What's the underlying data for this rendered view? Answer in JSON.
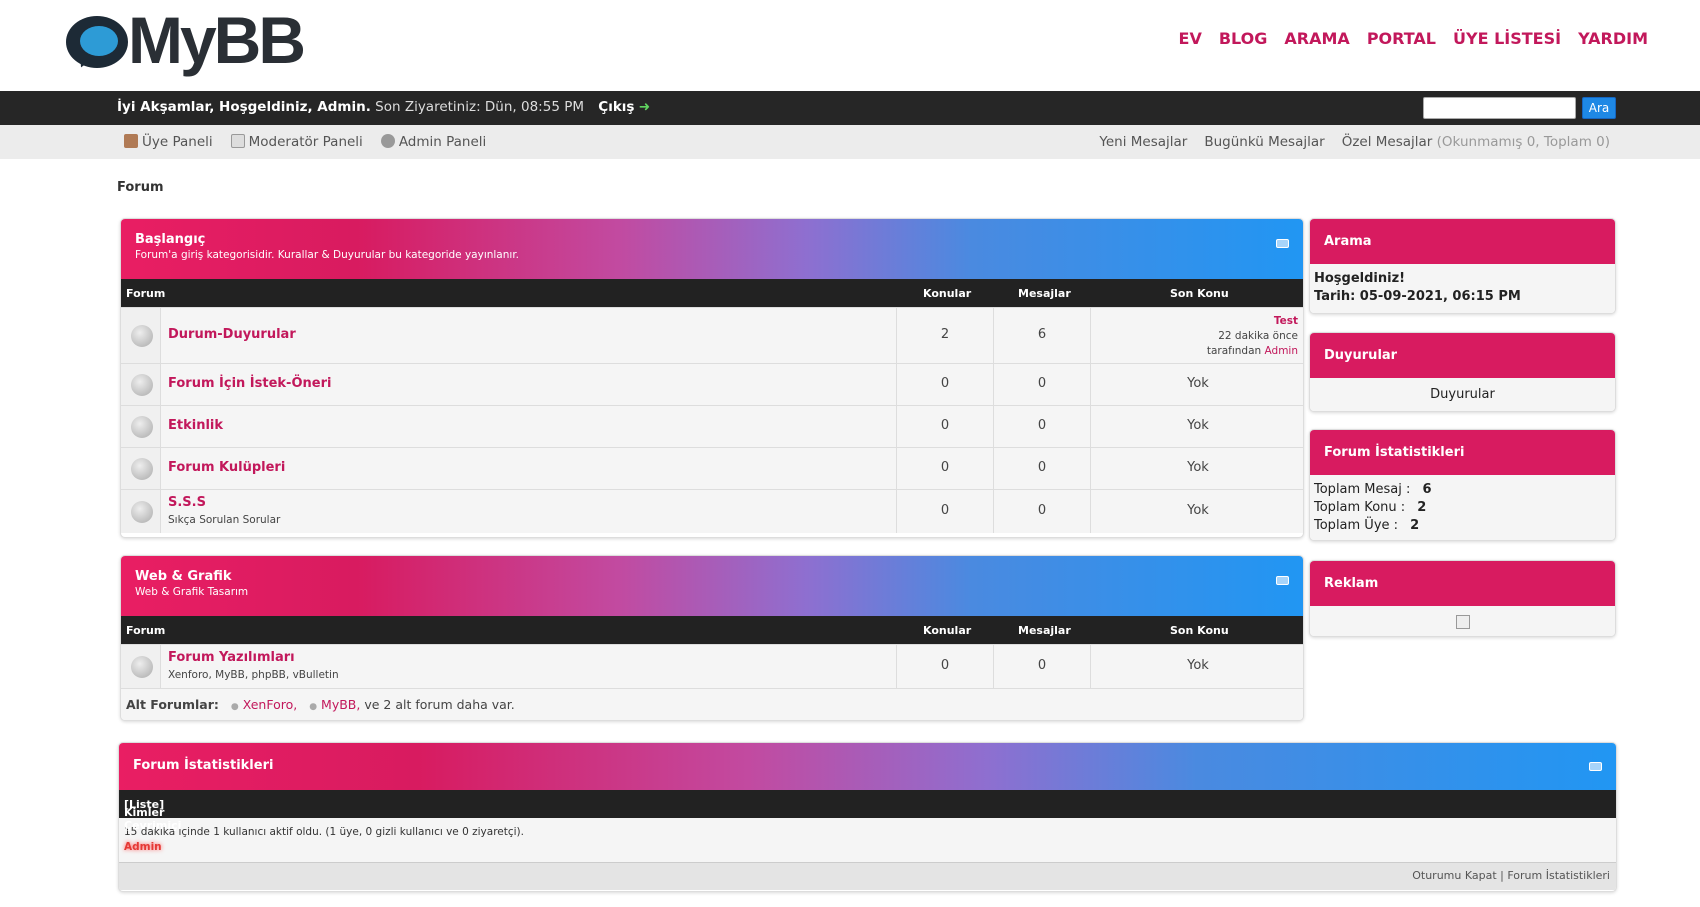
{
  "header": {
    "logo_text": "MyBB",
    "nav": [
      "EV",
      "BLOG",
      "ARAMA",
      "PORTAL",
      "ÜYE LİSTESİ",
      "YARDIM"
    ]
  },
  "welcome": {
    "greeting": "İyi Akşamlar, Hoşgeldiniz, Admin.",
    "last_visit": "Son Ziyaretiniz: Dün, 08:55 PM",
    "logout": "Çıkış",
    "arrow": "➜"
  },
  "search": {
    "button": "Ara",
    "value": ""
  },
  "panel": {
    "links": [
      "Üye Paneli",
      "Moderatör Paneli",
      "Admin Paneli"
    ],
    "right": [
      "Yeni Mesajlar",
      "Bugünkü Mesajlar",
      "Özel Mesajlar"
    ],
    "pm_count": "(Okunmamış 0, Toplam 0)"
  },
  "breadcrumb": "Forum",
  "columns": {
    "forum": "Forum",
    "topics": "Konular",
    "posts": "Mesajlar",
    "last": "Son Konu"
  },
  "categories": [
    {
      "title": "Başlangıç",
      "desc": "Forum'a giriş kategorisidir. Kurallar & Duyurular bu kategoride yayınlanır.",
      "forums": [
        {
          "name": "Durum-Duyurular",
          "sub": "",
          "topics": "2",
          "posts": "6",
          "last_title": "Test",
          "last_time": "22 dakika önce",
          "last_by": "tarafından",
          "last_user": "Admin"
        },
        {
          "name": "Forum İçin İstek-Öneri",
          "sub": "",
          "topics": "0",
          "posts": "0",
          "last": "Yok"
        },
        {
          "name": "Etkinlik",
          "sub": "",
          "topics": "0",
          "posts": "0",
          "last": "Yok"
        },
        {
          "name": "Forum Kulüpleri",
          "sub": "",
          "topics": "0",
          "posts": "0",
          "last": "Yok"
        },
        {
          "name": "S.S.S",
          "sub": "Sıkça Sorulan Sorular",
          "topics": "0",
          "posts": "0",
          "last": "Yok"
        }
      ]
    },
    {
      "title": "Web & Grafik",
      "desc": "Web & Grafik Tasarım",
      "forums": [
        {
          "name": "Forum Yazılımları",
          "sub": "Xenforo, MyBB, phpBB, vBulletin",
          "topics": "0",
          "posts": "0",
          "last": "Yok"
        }
      ],
      "subforums_label": "Alt Forumlar:",
      "subforums": [
        "XenForo,",
        "MyBB,"
      ],
      "subforums_more": "ve 2 alt forum daha var."
    }
  ],
  "sidebar": {
    "search": {
      "title": "Arama",
      "welcome": "Hoşgeldiniz!",
      "date": "Tarih: 05-09-2021, 06:15 PM"
    },
    "announcements": {
      "title": "Duyurular",
      "body": "Duyurular"
    },
    "stats": {
      "title": "Forum İstatistikleri",
      "rows": [
        {
          "label": "Toplam Mesaj :",
          "value": "6"
        },
        {
          "label": "Toplam Konu :",
          "value": "2"
        },
        {
          "label": "Toplam Üye :",
          "value": "2"
        }
      ]
    },
    "ads": {
      "title": "Reklam"
    }
  },
  "board_stats": {
    "title": "Forum İstatistikleri",
    "whos_online": "Kimler Çevrimiçi",
    "list_link": "[Liste]",
    "online_text": "15 dakika içinde 1 kullanıcı aktif oldu. (1 üye, 0 gizli kullanıcı ve 0 ziyaretçi).",
    "online_user": "Admin",
    "footer_links": "Oturumu Kapat | Forum İstatistikleri"
  },
  "colors": {
    "accent": "#c2185b",
    "bar": "#262626",
    "button": "#1e88e5"
  }
}
